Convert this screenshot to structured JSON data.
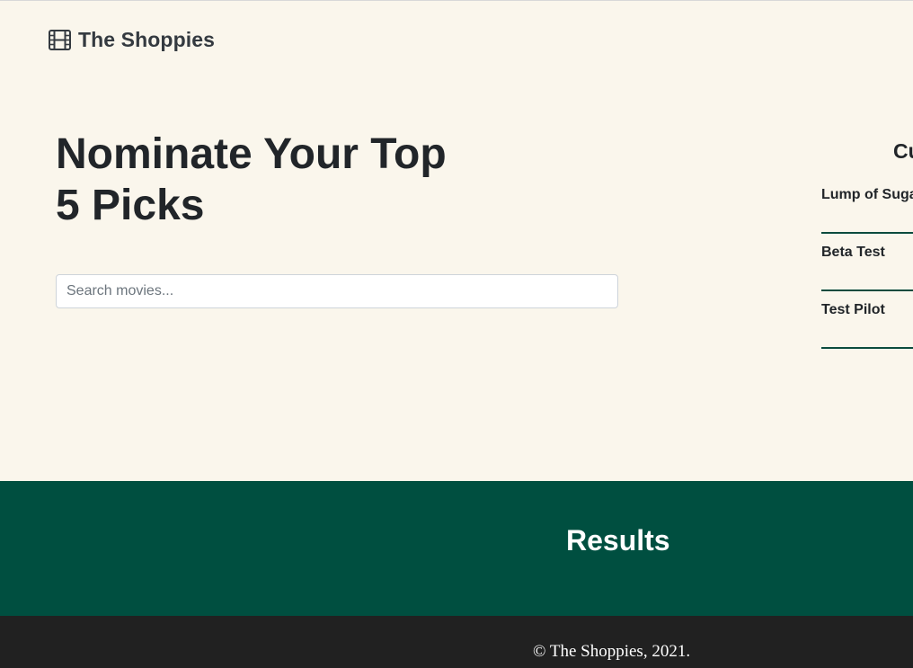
{
  "brand": {
    "name": "The Shoppies",
    "icon": "film-icon"
  },
  "hero": {
    "title_line1": "Nominate Your Top",
    "title_line2": "5 Picks"
  },
  "search": {
    "placeholder": "Search movies...",
    "value": ""
  },
  "nominations": {
    "heading": "Cu",
    "items": [
      {
        "label": "Lump of Suga"
      },
      {
        "label": "Beta Test"
      },
      {
        "label": "Test Pilot"
      }
    ]
  },
  "results": {
    "title": "Results"
  },
  "footer": {
    "text": "The Shoppies, 2021.",
    "symbol": "©"
  },
  "colors": {
    "page_bg": "#faf6ec",
    "accent_green": "#004f40",
    "footer_bg": "#212121",
    "text_dark": "#212529"
  }
}
